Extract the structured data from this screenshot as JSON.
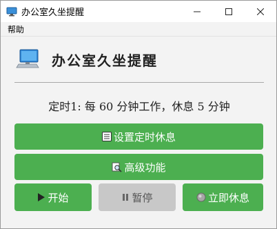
{
  "window": {
    "title": "办公室久坐提醒",
    "icon": "monitor-icon",
    "controls": {
      "minimize": "—",
      "maximize": "☐",
      "close": "✕"
    }
  },
  "menubar": {
    "items": [
      "帮助"
    ]
  },
  "header": {
    "icon": "computer-icon",
    "title": "办公室久坐提醒"
  },
  "status": {
    "text": "定时1: 每 60 分钟工作，休息 5 分钟"
  },
  "buttons": {
    "settings": {
      "label": "设置定时休息",
      "icon": "list-icon"
    },
    "advanced": {
      "label": "高级功能",
      "icon": "magnifier-doc-icon"
    },
    "start": {
      "label": "开始",
      "icon": "play-icon"
    },
    "pause": {
      "label": "暂停",
      "icon": "pause-icon"
    },
    "rest": {
      "label": "立即休息",
      "icon": "circle-icon"
    }
  },
  "colors": {
    "accent": "#4caf50",
    "disabled": "#c8c8c8"
  }
}
